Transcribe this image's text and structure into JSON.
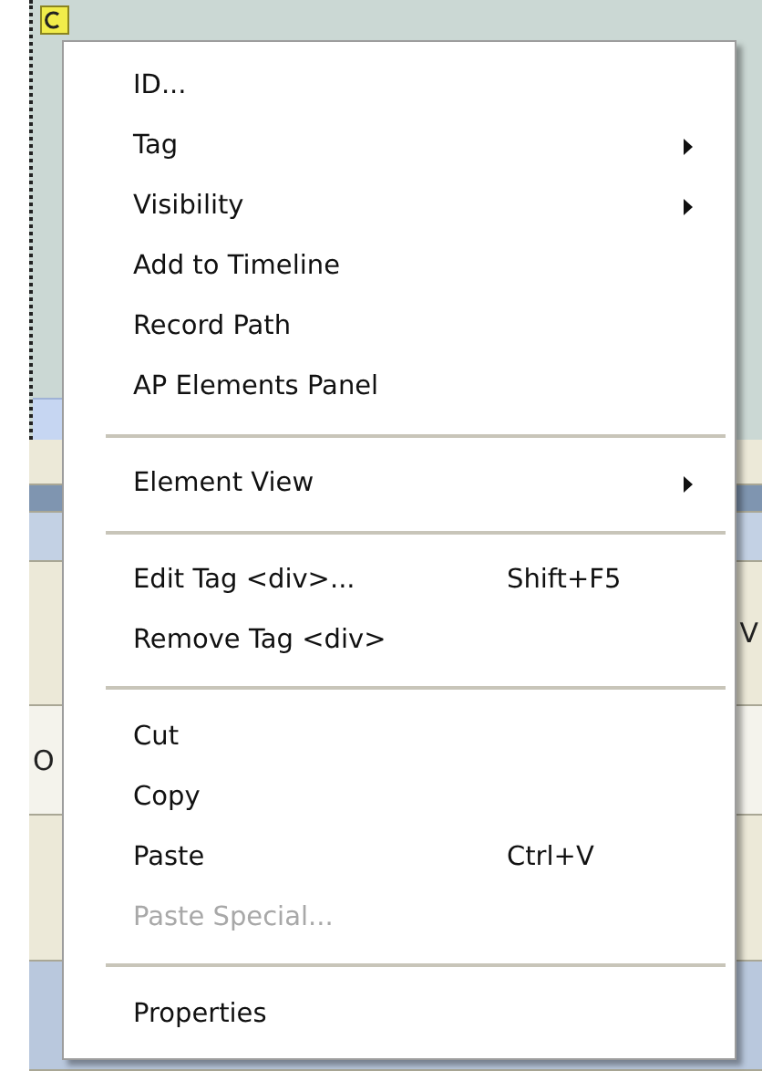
{
  "background": {
    "left_label": "O",
    "right_label": "V"
  },
  "menu": [
    {
      "kind": "item",
      "label": "ID...",
      "disabled": false,
      "submenu": false
    },
    {
      "kind": "item",
      "label": "Tag",
      "disabled": false,
      "submenu": true
    },
    {
      "kind": "item",
      "label": "Visibility",
      "disabled": false,
      "submenu": true
    },
    {
      "kind": "item",
      "label": "Add to Timeline",
      "disabled": false,
      "submenu": false
    },
    {
      "kind": "item",
      "label": "Record Path",
      "disabled": false,
      "submenu": false
    },
    {
      "kind": "item",
      "label": "AP Elements Panel",
      "disabled": false,
      "submenu": false
    },
    {
      "kind": "separator"
    },
    {
      "kind": "item",
      "label": "Element View",
      "disabled": false,
      "submenu": true
    },
    {
      "kind": "separator"
    },
    {
      "kind": "item",
      "label": "Edit Tag <div>...",
      "shortcut": "Shift+F5",
      "disabled": false,
      "submenu": false
    },
    {
      "kind": "item",
      "label": "Remove Tag <div>",
      "disabled": false,
      "submenu": false
    },
    {
      "kind": "separator"
    },
    {
      "kind": "item",
      "label": "Cut",
      "disabled": false,
      "submenu": false
    },
    {
      "kind": "item",
      "label": "Copy",
      "disabled": false,
      "submenu": false
    },
    {
      "kind": "item",
      "label": "Paste",
      "shortcut": "Ctrl+V",
      "disabled": false,
      "submenu": false
    },
    {
      "kind": "item",
      "label": "Paste Special...",
      "disabled": true,
      "submenu": false
    },
    {
      "kind": "separator"
    },
    {
      "kind": "item",
      "label": "Properties",
      "disabled": false,
      "submenu": false
    }
  ]
}
